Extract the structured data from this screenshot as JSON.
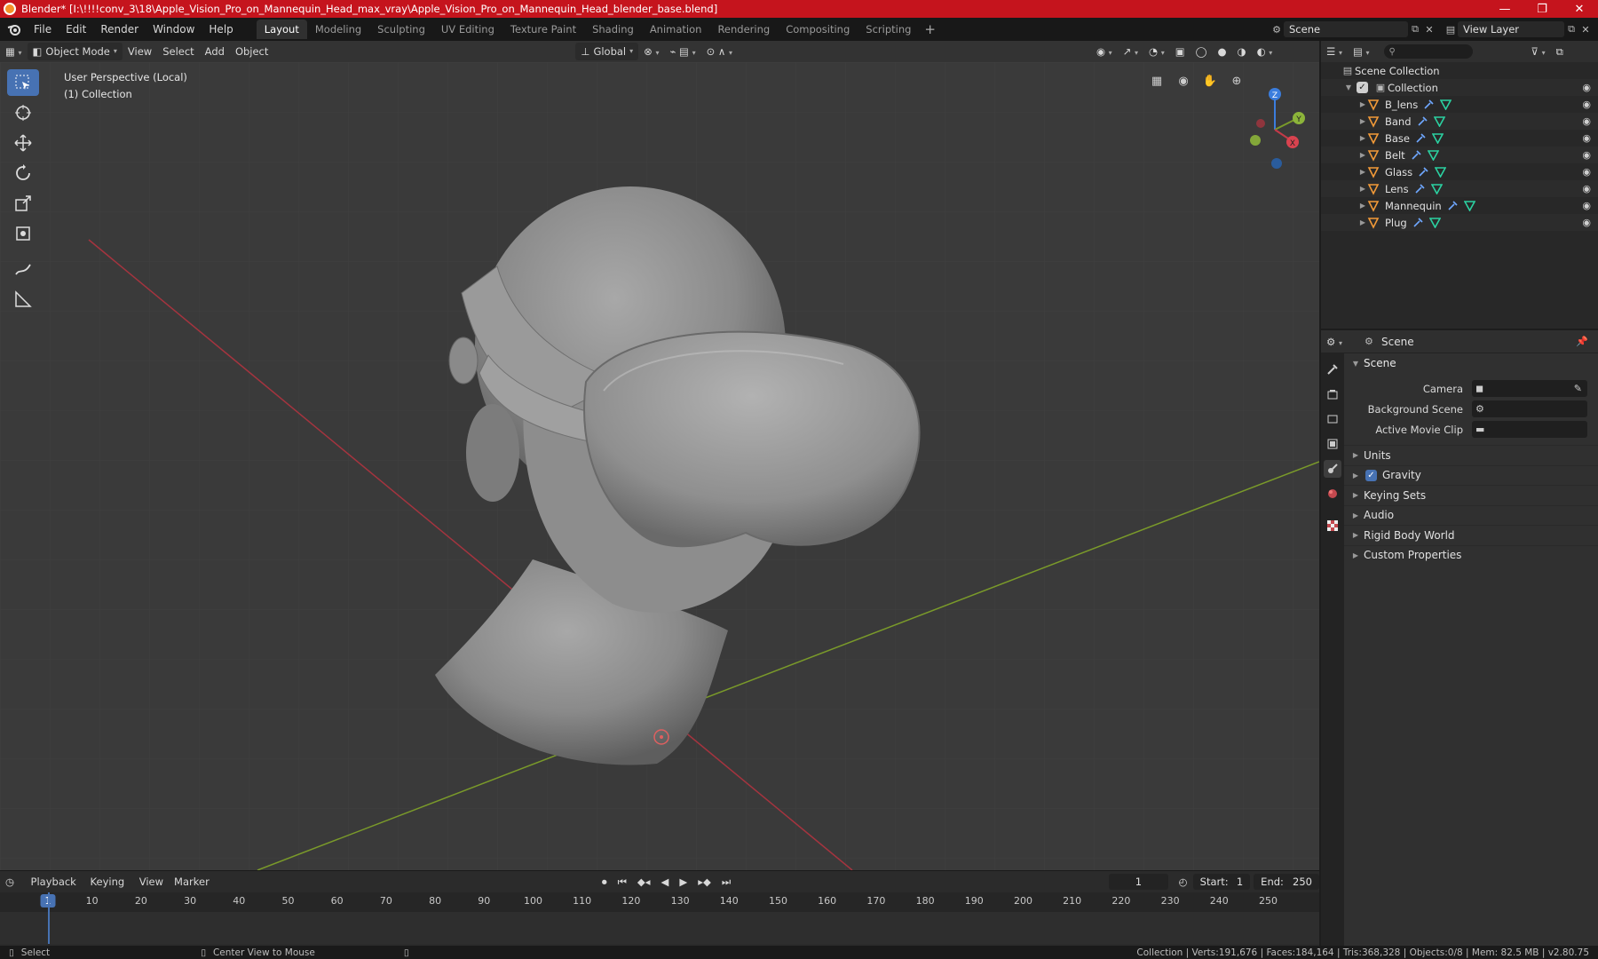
{
  "window": {
    "title": "Blender* [I:\\!!!!conv_3\\18\\Apple_Vision_Pro_on_Mannequin_Head_max_vray\\Apple_Vision_Pro_on_Mannequin_Head_blender_base.blend]",
    "controls": [
      "—",
      "❐",
      "✕"
    ]
  },
  "menu": [
    "File",
    "Edit",
    "Render",
    "Window",
    "Help"
  ],
  "workspaces": [
    "Layout",
    "Modeling",
    "Sculpting",
    "UV Editing",
    "Texture Paint",
    "Shading",
    "Animation",
    "Rendering",
    "Compositing",
    "Scripting"
  ],
  "active_workspace": "Layout",
  "scene_name": "Scene",
  "view_layer": "View Layer",
  "viewport": {
    "mode": "Object Mode",
    "menus": [
      "View",
      "Select",
      "Add",
      "Object"
    ],
    "transform_orientation": "Global",
    "perspective_label": "User Perspective (Local)",
    "collection_label": "(1) Collection",
    "axis_labels": {
      "x": "X",
      "y": "Y",
      "z": "Z"
    }
  },
  "outliner": {
    "root": "Scene Collection",
    "collection": "Collection",
    "objects": [
      "B_lens",
      "Band",
      "Base",
      "Belt",
      "Glass",
      "Lens",
      "Mannequin",
      "Plug"
    ]
  },
  "properties": {
    "header": "Scene",
    "panel": "Scene",
    "fields": [
      {
        "label": "Camera"
      },
      {
        "label": "Background Scene"
      },
      {
        "label": "Active Movie Clip"
      }
    ],
    "subpanels": [
      "Units",
      "Gravity",
      "Keying Sets",
      "Audio",
      "Rigid Body World",
      "Custom Properties"
    ]
  },
  "timeline": {
    "menus": [
      "Playback",
      "Keying",
      "View",
      "Marker"
    ],
    "current_frame": "1",
    "start_label": "Start:",
    "start": "1",
    "end_label": "End:",
    "end": "250",
    "ticks": [
      "10",
      "20",
      "30",
      "40",
      "50",
      "60",
      "70",
      "80",
      "90",
      "100",
      "110",
      "120",
      "130",
      "140",
      "150",
      "160",
      "170",
      "180",
      "190",
      "200",
      "210",
      "220",
      "230",
      "240",
      "250"
    ]
  },
  "status": {
    "left_action": "Select",
    "mid_action": "Center View to Mouse",
    "stats": "Collection | Verts:191,676 | Faces:184,164 | Tris:368,328 | Objects:0/8 | Mem: 82.5 MB | v2.80.75"
  },
  "colors": {
    "titlebar": "#c5141d",
    "accent": "#4772b3",
    "viewport_bg": "#3a3a3a",
    "x_axis": "#a5343f",
    "y_axis": "#7a9a2a",
    "z_axis": "#3b7ddd"
  }
}
